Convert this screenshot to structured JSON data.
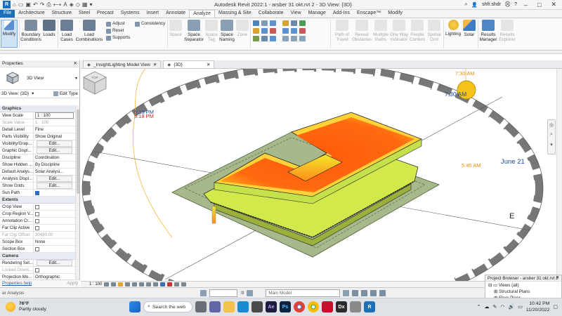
{
  "titlebar": {
    "title": "Autodesk Revit 2022.1 - arsber 31 okt.rvt 2 - 3D View: {3D}",
    "user": "shfr.shdr",
    "help": "?"
  },
  "tabs": [
    "File",
    "Architecture",
    "Structure",
    "Steel",
    "Precast",
    "Systems",
    "Insert",
    "Annotate",
    "Analyze",
    "Massing & Site",
    "Collaborate",
    "View",
    "Manage",
    "Add-Ins",
    "Enscape™",
    "Modify"
  ],
  "active_tab": "Analyze",
  "ribbon": {
    "modify": "Modify",
    "boundary": "Boundary Conditions",
    "loads": "Loads",
    "load_cases": "Load Cases",
    "load_combinations": "Load Combinations",
    "adjust": "Adjust",
    "reset": "Reset",
    "supports": "Supports",
    "consistency": "Consistency",
    "space": "Space",
    "space_separator": "Space Separator",
    "space_tag": "Space Tag",
    "space_naming": "Space Naming",
    "zone": "Zone",
    "path_of_travel": "Path of Travel",
    "reveal_obstacles": "Reveal Obstacles",
    "multiple_paths": "Multiple Paths",
    "one_way_indicator": "One Way Indicator",
    "people_content": "People Content",
    "spatial_grid": "Spatial Grid",
    "lighting": "Lighting",
    "solar": "Solar",
    "results_manager": "Results Manager",
    "results_explorer": "Results Explorer"
  },
  "properties": {
    "title": "Properties",
    "type_name": "3D View",
    "view_selector": "3D View: {3D}",
    "edit_type": "Edit Type",
    "sections": [
      {
        "name": "Graphics",
        "rows": [
          {
            "k": "View Scale",
            "v": "1 : 100",
            "style": "boxed"
          },
          {
            "k": "Scale Value",
            "v": "100",
            "pre": "1:",
            "dim": true
          },
          {
            "k": "Detail Level",
            "v": "Fine"
          },
          {
            "k": "Parts Visibility",
            "v": "Show Original"
          },
          {
            "k": "Visibility/Grap...",
            "v": "Edit...",
            "style": "btn"
          },
          {
            "k": "Graphic Displ...",
            "v": "Edit...",
            "style": "btn"
          },
          {
            "k": "Discipline",
            "v": "Coordination"
          },
          {
            "k": "Show Hidden ...",
            "v": "By Discipline"
          },
          {
            "k": "Default Analys...",
            "v": "Solar Analysi..."
          },
          {
            "k": "Analysis Displ...",
            "v": "Edit...",
            "style": "btn"
          },
          {
            "k": "Show Grids",
            "v": "Edit...",
            "style": "btn"
          },
          {
            "k": "Sun Path",
            "v": "",
            "check": "on"
          }
        ]
      },
      {
        "name": "Extents",
        "rows": [
          {
            "k": "Crop View",
            "v": "",
            "check": "off"
          },
          {
            "k": "Crop Region V...",
            "v": "",
            "check": "off"
          },
          {
            "k": "Annotation Cr...",
            "v": "",
            "check": "off"
          },
          {
            "k": "Far Clip Active",
            "v": "",
            "check": "off"
          },
          {
            "k": "Far Clip Offset",
            "v": "30480.00",
            "dim": true
          },
          {
            "k": "Scope Box",
            "v": "None"
          },
          {
            "k": "Section Box",
            "v": "",
            "check": "off"
          }
        ]
      },
      {
        "name": "Camera",
        "rows": [
          {
            "k": "Rendering Set...",
            "v": "Edit...",
            "style": "btn"
          },
          {
            "k": "Locked Orient...",
            "v": "",
            "check": "off",
            "dim": true
          },
          {
            "k": "Projection Mo...",
            "v": "Orthographic"
          }
        ]
      }
    ],
    "help_link": "Properties help",
    "apply": "Apply"
  },
  "view_tabs": [
    {
      "label": "_InsightLighting Model View",
      "active": false
    },
    {
      "label": "{3D}",
      "active": true
    }
  ],
  "canvas": {
    "labels": {
      "t1": "5:18 PM",
      "t2": "5:18 PM",
      "t3": "7:30 AM",
      "t4": "7:30 AM",
      "t5": "5:45 AM",
      "date": "June 21",
      "east": "E"
    },
    "viewcube": "TOP"
  },
  "viewctrl": {
    "scale": "1 : 100"
  },
  "project_browser": {
    "title": "Project Browser - arsber 31 okt.rvt 2",
    "items": [
      "Views (all)",
      "Structural Plans",
      "Floor Plans"
    ]
  },
  "statusbar": {
    "left": "ar Analysis",
    "zero": ":0",
    "model": "Main Model"
  },
  "taskbar": {
    "temp": "76°F",
    "weather": "Partly cloudy",
    "search": "Search the web",
    "time": "10:42 PM",
    "date": "11/20/2022"
  }
}
